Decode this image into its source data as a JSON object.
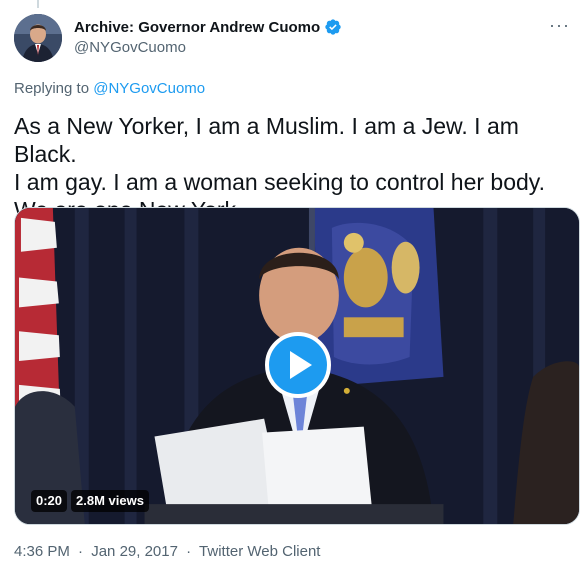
{
  "author": {
    "display_name": "Archive: Governor Andrew Cuomo",
    "handle": "@NYGovCuomo",
    "verified": true,
    "avatar_icon": "profile-photo"
  },
  "more_menu_icon": "more-options-icon",
  "reply_context": {
    "prefix": "Replying to",
    "mention": "@NYGovCuomo"
  },
  "tweet": {
    "text": "As a New Yorker, I am a Muslim. I am a Jew. I am Black.\nI am gay. I am a woman seeking to control her body.\nWe are one New York."
  },
  "video": {
    "duration": "0:20",
    "views": "2.8M views",
    "play_icon": "play-icon"
  },
  "metadata": {
    "time": "4:36 PM",
    "date": "Jan 29, 2017",
    "source": "Twitter Web Client",
    "separator": "·"
  },
  "colors": {
    "accent": "#1d9bf0",
    "secondary_text": "#536471",
    "primary_text": "#0f1419"
  }
}
